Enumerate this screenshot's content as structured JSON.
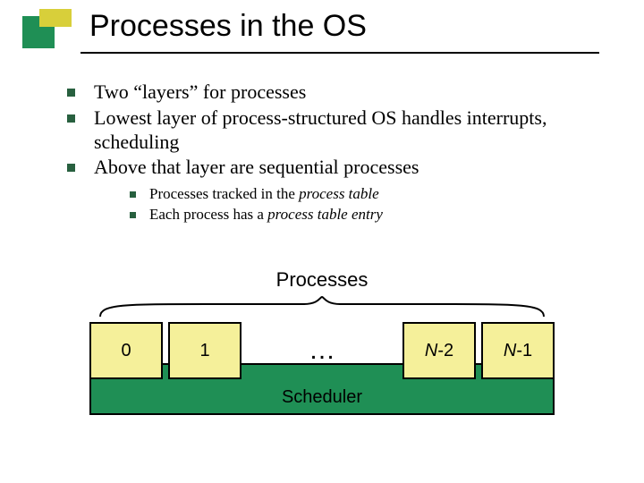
{
  "title": "Processes in the OS",
  "bullets": {
    "b0": "Two “layers” for processes",
    "b1": "Lowest layer of process-structured OS handles interrupts, scheduling",
    "b2": "Above that layer are sequential processes",
    "sub0_pre": "Processes tracked in the ",
    "sub0_ital": "process table",
    "sub1_pre": "Each process has a ",
    "sub1_ital": "process table entry"
  },
  "diagram": {
    "group_label": "Processes",
    "boxes": {
      "p0": "0",
      "p1": "1",
      "dots": "…",
      "pNm2_pre": "N",
      "pNm2_suf": "-2",
      "pNm1_pre": "N",
      "pNm1_suf": "-1"
    },
    "scheduler": "Scheduler"
  }
}
